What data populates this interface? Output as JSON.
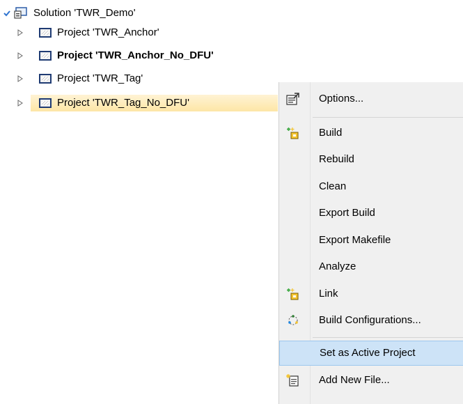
{
  "tree": {
    "solution_label": "Solution 'TWR_Demo'",
    "projects": [
      {
        "label": "Project 'TWR_Anchor'"
      },
      {
        "label": "Project 'TWR_Anchor_No_DFU'"
      },
      {
        "label": "Project 'TWR_Tag'"
      },
      {
        "label": "Project 'TWR_Tag_No_DFU'"
      }
    ]
  },
  "context_menu": {
    "items": [
      {
        "label": "Options...",
        "icon": "options-icon"
      },
      {
        "label": "Build",
        "icon": "build-icon"
      },
      {
        "label": "Rebuild",
        "icon": ""
      },
      {
        "label": "Clean",
        "icon": ""
      },
      {
        "label": "Export Build",
        "icon": ""
      },
      {
        "label": "Export Makefile",
        "icon": ""
      },
      {
        "label": "Analyze",
        "icon": ""
      },
      {
        "label": "Link",
        "icon": "link-icon"
      },
      {
        "label": "Build Configurations...",
        "icon": "build-configurations-icon"
      },
      {
        "label": "Set as Active Project",
        "icon": ""
      },
      {
        "label": "Add New File...",
        "icon": "add-new-file-icon"
      }
    ]
  },
  "colors": {
    "selection_bg": "#fde6a6",
    "menu_bg": "#f0f0f0",
    "menu_highlight": "#cde3f7",
    "project_icon_border": "#1f3b73"
  }
}
